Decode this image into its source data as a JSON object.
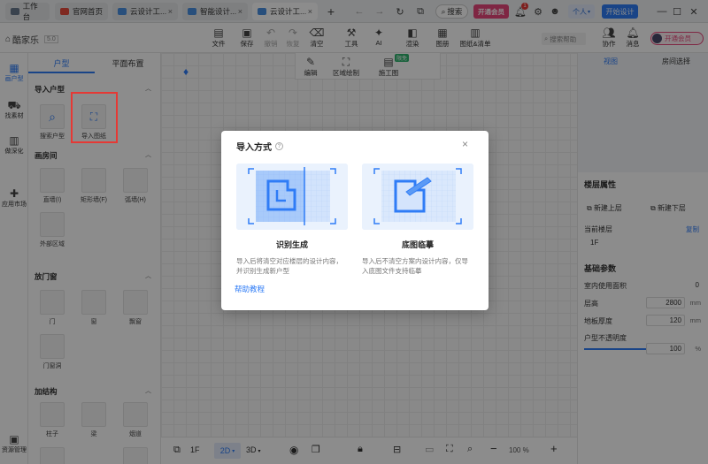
{
  "browser": {
    "tabs": [
      {
        "label": "工作台",
        "active": false
      },
      {
        "label": "官网首页",
        "active": false
      },
      {
        "label": "云设计工...",
        "active": false
      },
      {
        "label": "智能设计...",
        "active": false
      },
      {
        "label": "云设计工...",
        "active": true
      }
    ],
    "search_label": "搜索",
    "vip_label": "开通会员",
    "notification_count": "1",
    "profile_label": "个人",
    "start_design_label": "开始设计"
  },
  "app": {
    "logo": "酷家乐",
    "version": "5.0",
    "tools": [
      {
        "label": "文件",
        "icon": "folder-icon"
      },
      {
        "label": "保存",
        "icon": "save-icon"
      },
      {
        "label": "撤销",
        "icon": "undo-icon"
      },
      {
        "label": "恢复",
        "icon": "redo-icon"
      },
      {
        "label": "清空",
        "icon": "eraser-icon"
      },
      {
        "label": "工具",
        "icon": "hammer-icon"
      },
      {
        "label": "AI",
        "icon": "ai-icon"
      },
      {
        "label": "渲染",
        "icon": "render-icon"
      },
      {
        "label": "图册",
        "icon": "album-icon"
      },
      {
        "label": "图纸&清单",
        "icon": "drawing-icon"
      }
    ],
    "help_search_placeholder": "搜索帮助",
    "collab_label": "协作",
    "msg_label": "消息",
    "vip_label": "开通会员"
  },
  "rail": {
    "items": [
      {
        "label": "画户型"
      },
      {
        "label": "找素材"
      },
      {
        "label": "做深化"
      },
      {
        "label": "应用市场"
      },
      {
        "label": "资源管理"
      }
    ]
  },
  "panel": {
    "tabs": [
      "户型",
      "平面布置"
    ],
    "sections": [
      {
        "title": "导入户型",
        "items": [
          "搜索户型",
          "导入图纸"
        ]
      },
      {
        "title": "画房间",
        "items": [
          "直墙(I)",
          "矩形墙(F)",
          "弧墙(H)",
          "外部区域"
        ]
      },
      {
        "title": "放门窗",
        "items": [
          "门",
          "窗",
          "飘窗",
          "门窗洞"
        ]
      },
      {
        "title": "加结构",
        "items": [
          "柱子",
          "梁",
          "烟道"
        ]
      }
    ]
  },
  "canvas_tools": [
    {
      "label": "编辑"
    },
    {
      "label": "区域绘制"
    },
    {
      "label": "施工图",
      "badge": "限免"
    }
  ],
  "bottom": {
    "floor": "1F",
    "mode2d": "2D",
    "mode3d": "3D",
    "zoom": "100",
    "zoom_unit": "%"
  },
  "rpanel": {
    "tabs": [
      "视图",
      "房间选择"
    ],
    "floor_title": "楼层属性",
    "add_upper": "新建上层",
    "add_lower": "新建下层",
    "current_floor_label": "当前楼层",
    "current_floor_action": "复制",
    "current_floor_value": "1F",
    "params_title": "基础参数",
    "rows": [
      {
        "label": "室内使用面积",
        "value": "0"
      },
      {
        "label": "层高",
        "value": "2800",
        "unit": "mm"
      },
      {
        "label": "地板厚度",
        "value": "120",
        "unit": "mm"
      },
      {
        "label": "户型不透明度",
        "value": "100",
        "unit": "%"
      }
    ]
  },
  "modal": {
    "title": "导入方式",
    "options": [
      {
        "title": "识别生成",
        "desc": "导入后将清空对应楼层的设计内容，并识别生成新户型"
      },
      {
        "title": "底图临摹",
        "desc": "导入后不清空方案内设计内容，仅导入底图文件支持临摹"
      }
    ],
    "help_link": "帮助教程"
  }
}
